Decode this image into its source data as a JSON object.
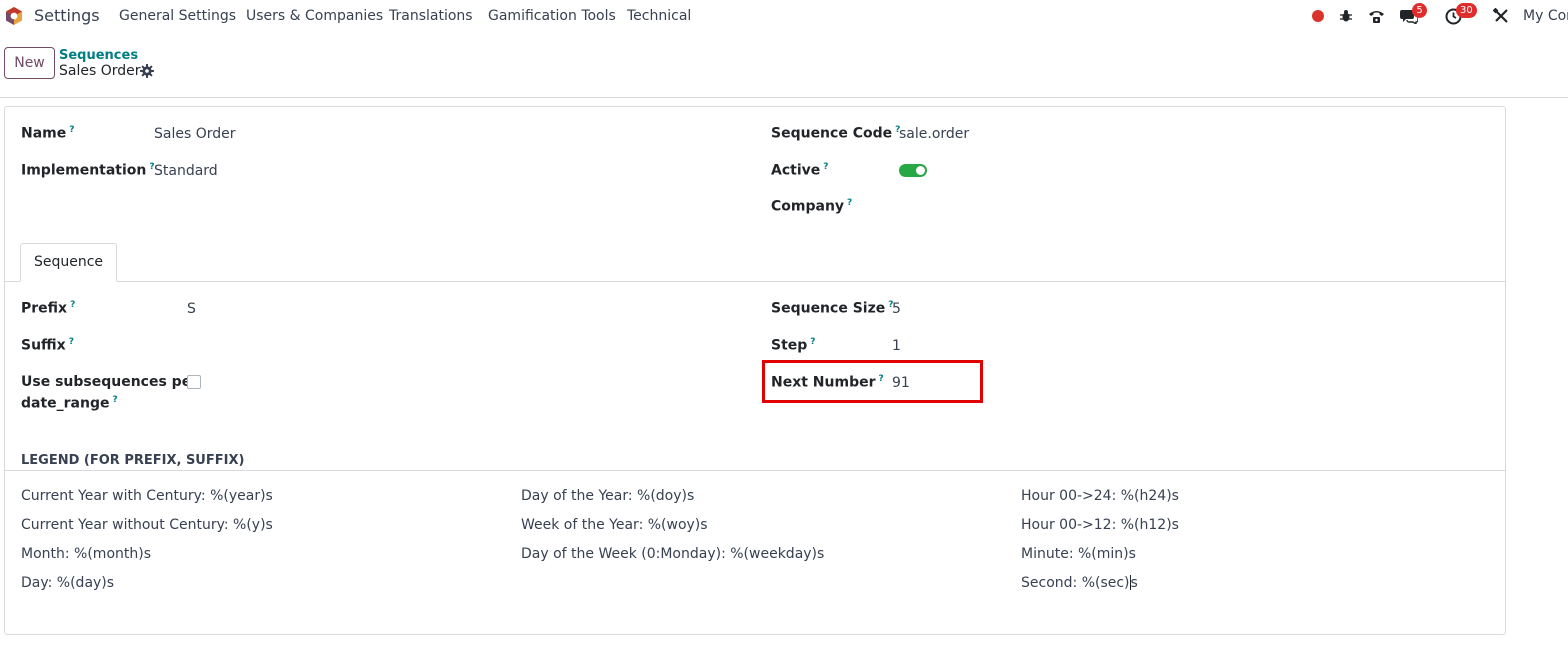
{
  "navbar": {
    "app_name": "Settings",
    "menus": [
      "General Settings",
      "Users & Companies",
      "Translations",
      "Gamification Tools",
      "Technical"
    ],
    "messages_count": "5",
    "activities_count": "30",
    "company": "My Com"
  },
  "control_panel": {
    "new_label": "New",
    "breadcrumb": "Sequences",
    "record_title": "Sales Order"
  },
  "form": {
    "name_label": "Name",
    "name_value": "Sales Order",
    "implementation_label": "Implementation",
    "implementation_value": "Standard",
    "sequence_code_label": "Sequence Code",
    "sequence_code_value": "sale.order",
    "active_label": "Active",
    "active_value": true,
    "company_label": "Company",
    "question_mark": "?"
  },
  "tab": {
    "label": "Sequence"
  },
  "sequence": {
    "prefix_label": "Prefix",
    "prefix_value": "S",
    "suffix_label": "Suffix",
    "subseq_label_line1": "Use subsequences per",
    "subseq_label_line2": "date_range",
    "subseq_checked": false,
    "size_label": "Sequence Size",
    "size_value": "5",
    "step_label": "Step",
    "step_value": "1",
    "next_label": "Next Number",
    "next_value": "91"
  },
  "legend": {
    "title": "LEGEND (FOR PREFIX, SUFFIX)",
    "col1": [
      "Current Year with Century: %(year)s",
      "Current Year without Century: %(y)s",
      "Month: %(month)s",
      "Day: %(day)s"
    ],
    "col2": [
      "Day of the Year: %(doy)s",
      "Week of the Year: %(woy)s",
      "Day of the Week (0:Monday): %(weekday)s"
    ],
    "col3": [
      "Hour 00->24: %(h24)s",
      "Hour 00->12: %(h12)s",
      "Minute: %(min)s"
    ],
    "col3_last_a": "Second: %(sec)",
    "col3_last_b": "s"
  },
  "colors": {
    "brand": "#714B67",
    "link": "#017e84",
    "toggle_on": "#28a745",
    "highlight": "#e10000",
    "badge": "#e02c2c"
  }
}
